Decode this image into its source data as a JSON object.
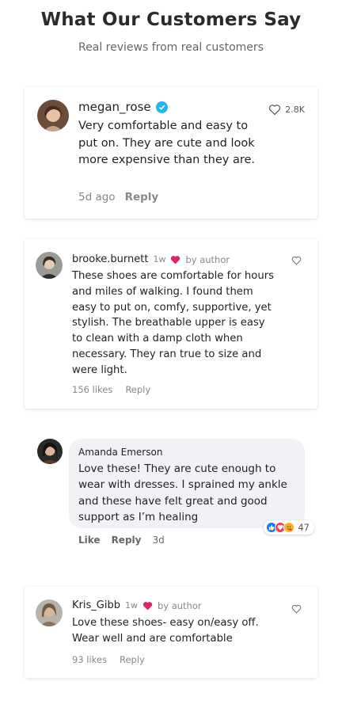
{
  "header": {
    "title": "What Our Customers Say",
    "subtitle": "Real reviews from real customers"
  },
  "reviews": [
    {
      "username": "megan_rose",
      "text": "Very comfortable and easy to put on. They are cute and look more expensive than they are.",
      "time": "5d ago",
      "reply_label": "Reply",
      "likes": "2.8K",
      "verified": true
    },
    {
      "username": "brooke.burnett",
      "time": "1w",
      "by_author": "by author",
      "text": "These shoes are comfortable for hours and miles of walking. I found them easy to put on, comfy, supportive, yet stylish. The breathable upper is easy to clean with a damp cloth when necessary. They ran true to size and were light.",
      "likes": "156 likes",
      "reply_label": "Reply"
    },
    {
      "username": "Amanda Emerson",
      "text": "Love these! They are cute enough to wear with dresses. I sprained my ankle and these have felt great and good support as I’m healing",
      "reaction_count": "47",
      "like_label": "Like",
      "reply_label": "Reply",
      "time": "3d"
    },
    {
      "username": "Kris_Gibb",
      "time": "1w",
      "by_author": "by author",
      "text": "Love these shoes- easy on/easy off. Wear well and are comfortable",
      "likes": "93 likes",
      "reply_label": "Reply"
    }
  ],
  "colors": {
    "verified": "#20b6f0",
    "heart_red": "#e0245e",
    "fb_like": "#1877f2",
    "fb_love": "#f33e58",
    "fb_care": "#f7b125"
  }
}
